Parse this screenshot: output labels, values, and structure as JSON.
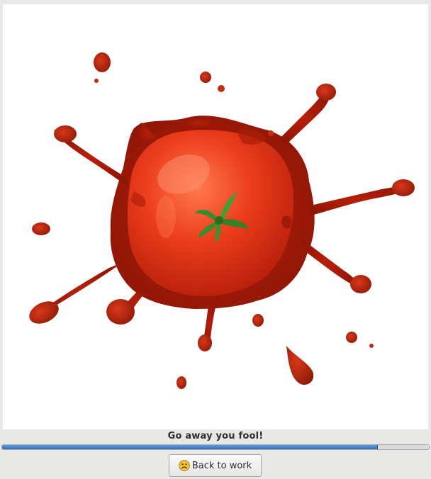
{
  "dialog": {
    "message": "Go away you fool!",
    "progress_fraction": 0.88,
    "button_label": "Back to work",
    "button_icon": "sad-face-icon"
  },
  "image": {
    "subject": "tomato-splat"
  },
  "colors": {
    "progress_fill": "#3a7bc8",
    "tomato_red": "#e23a1a",
    "sauce": "#c0280e",
    "stem_green": "#3f8a2a"
  }
}
